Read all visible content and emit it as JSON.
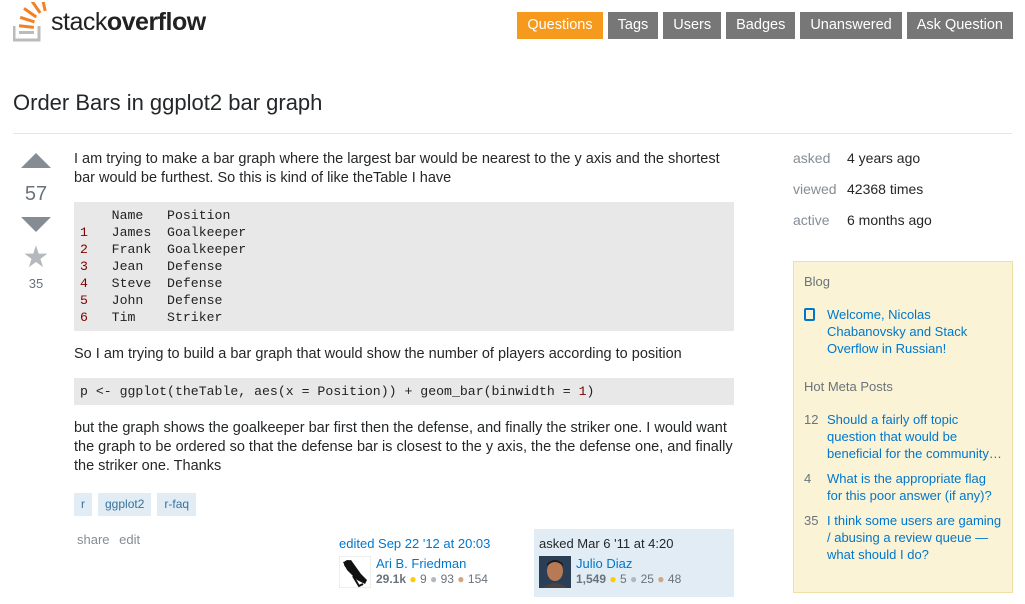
{
  "header": {
    "logo_text_light": "stack",
    "logo_text_bold": "overflow",
    "nav": [
      "Questions",
      "Tags",
      "Users",
      "Badges",
      "Unanswered",
      "Ask Question"
    ],
    "active_nav": "Questions"
  },
  "question": {
    "title": "Order Bars in ggplot2 bar graph",
    "votes": "57",
    "favorites": "35",
    "p1": "I am trying to make a bar graph where the largest bar would be nearest to the y axis and the shortest bar would be furthest. So this is kind of like theTable I have",
    "table_header": "    Name   Position",
    "table_rows": [
      {
        "n": "1",
        "text": "   James  Goalkeeper"
      },
      {
        "n": "2",
        "text": "   Frank  Goalkeeper"
      },
      {
        "n": "3",
        "text": "   Jean   Defense"
      },
      {
        "n": "4",
        "text": "   Steve  Defense"
      },
      {
        "n": "5",
        "text": "   John   Defense"
      },
      {
        "n": "6",
        "text": "   Tim    Striker"
      }
    ],
    "p2": "So I am trying to build a bar graph that would show the number of players according to position",
    "code_pre": "p <- ggplot(theTable, aes(x = Position)) + geom_bar(binwidth = ",
    "code_num": "1",
    "code_post": ")",
    "p3": "but the graph shows the goalkeeper bar first then the defense, and finally the striker one. I would want the graph to be ordered so that the defense bar is closest to the y axis, the the defense one, and finally the striker one. Thanks",
    "tags": [
      "r",
      "ggplot2",
      "r-faq"
    ],
    "menu": [
      "share",
      "edit"
    ]
  },
  "edited": {
    "action": "edited Sep 22 '12 at 20:03",
    "user": "Ari B. Friedman",
    "rep": "29.1k",
    "gold": "9",
    "silver": "93",
    "bronze": "154"
  },
  "asked": {
    "action": "asked Mar 6 '11 at 4:20",
    "user": "Julio Diaz",
    "rep": "1,549",
    "gold": "5",
    "silver": "25",
    "bronze": "48"
  },
  "stats": [
    {
      "key": "asked",
      "value": "4 years ago"
    },
    {
      "key": "viewed",
      "value": "42368 times"
    },
    {
      "key": "active",
      "value": "6 months ago"
    }
  ],
  "sidebar": {
    "blog_heading": "Blog",
    "blog_items": [
      {
        "text": "Welcome, Nicolas Chabanovsky and Stack Overflow in Russian!"
      }
    ],
    "meta_heading": "Hot Meta Posts",
    "meta_items": [
      {
        "count": "12",
        "text": "Should a fairly off topic question that would be beneficial for the community…"
      },
      {
        "count": "4",
        "text": "What is the appropriate flag for this poor answer (if any)?"
      },
      {
        "count": "35",
        "text": "I think some users are gaming / abusing a review queue — what should I do?"
      }
    ]
  },
  "colors": {
    "accent": "#f69a1e",
    "link": "#0077cc",
    "tag_bg": "#e1ecf4",
    "sidebar_bg": "#fbf3d5"
  }
}
